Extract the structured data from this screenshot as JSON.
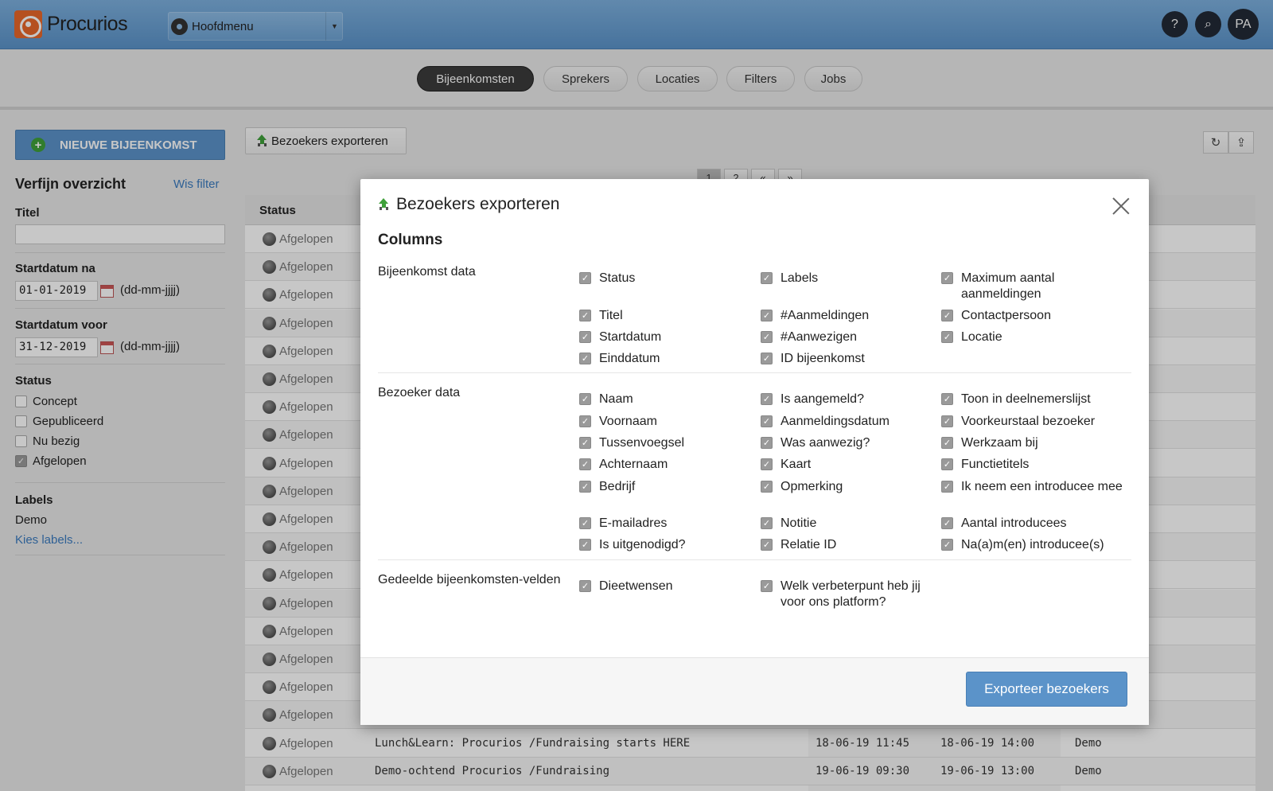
{
  "header": {
    "brand": "Procurios",
    "main_menu": "Hoofdmenu",
    "help": "?",
    "search": "⌕",
    "avatar_initials": "PA"
  },
  "tabs": [
    "Bijeenkomsten",
    "Sprekers",
    "Locaties",
    "Filters",
    "Jobs"
  ],
  "active_tab": "Bijeenkomsten",
  "sidebar": {
    "new_button": "NIEUWE BIJEENKOMST",
    "refine_title": "Verfijn overzicht",
    "clear_filter": "Wis filter",
    "title_label": "Titel",
    "title_value": "",
    "start_after_label": "Startdatum na",
    "start_after_value": "01-01-2019",
    "start_before_label": "Startdatum voor",
    "start_before_value": "31-12-2019",
    "date_hint": "(dd-mm-jjjj)",
    "status_label": "Status",
    "statuses": [
      {
        "label": "Concept",
        "checked": false
      },
      {
        "label": "Gepubliceerd",
        "checked": false
      },
      {
        "label": "Nu bezig",
        "checked": false
      },
      {
        "label": "Afgelopen",
        "checked": true
      }
    ],
    "labels_label": "Labels",
    "labels_value": "Demo",
    "choose_labels": "Kies labels..."
  },
  "content": {
    "export_button": "Bezoekers exporteren",
    "pages": [
      "1",
      "2",
      "«",
      "»"
    ],
    "status_header": "Status",
    "rows": [
      {
        "status": "Afgelopen",
        "title": "",
        "start": "",
        "end": "",
        "label": ""
      },
      {
        "status": "Afgelopen",
        "title": "",
        "start": "",
        "end": "",
        "label": ""
      },
      {
        "status": "Afgelopen",
        "title": "",
        "start": "",
        "end": "",
        "label": ""
      },
      {
        "status": "Afgelopen",
        "title": "",
        "start": "",
        "end": "",
        "label": ""
      },
      {
        "status": "Afgelopen",
        "title": "",
        "start": "",
        "end": "",
        "label": ""
      },
      {
        "status": "Afgelopen",
        "title": "",
        "start": "",
        "end": "",
        "label": ""
      },
      {
        "status": "Afgelopen",
        "title": "",
        "start": "",
        "end": "",
        "label": ""
      },
      {
        "status": "Afgelopen",
        "title": "",
        "start": "",
        "end": "",
        "label": ""
      },
      {
        "status": "Afgelopen",
        "title": "",
        "start": "",
        "end": "",
        "label": ""
      },
      {
        "status": "Afgelopen",
        "title": "",
        "start": "",
        "end": "",
        "label": ""
      },
      {
        "status": "Afgelopen",
        "title": "",
        "start": "",
        "end": "",
        "label": ""
      },
      {
        "status": "Afgelopen",
        "title": "",
        "start": "",
        "end": "",
        "label": ""
      },
      {
        "status": "Afgelopen",
        "title": "",
        "start": "",
        "end": "",
        "label": ""
      },
      {
        "status": "Afgelopen",
        "title": "",
        "start": "",
        "end": "",
        "label": ""
      },
      {
        "status": "Afgelopen",
        "title": "",
        "start": "",
        "end": "",
        "label": ""
      },
      {
        "status": "Afgelopen",
        "title": "",
        "start": "",
        "end": "",
        "label": ""
      },
      {
        "status": "Afgelopen",
        "title": "",
        "start": "",
        "end": "",
        "label": ""
      },
      {
        "status": "Afgelopen",
        "title": "",
        "start": "",
        "end": "",
        "label": ""
      },
      {
        "status": "Afgelopen",
        "title": "Lunch&Learn: Procurios /Fundraising starts HERE",
        "start": "18-06-19 11:45",
        "end": "18-06-19 14:00",
        "label": "Demo"
      },
      {
        "status": "Afgelopen",
        "title": "Demo-ochtend Procurios /Fundraising",
        "start": "19-06-19 09:30",
        "end": "19-06-19 13:00",
        "label": "Demo"
      }
    ]
  },
  "modal": {
    "title": "Bezoekers exporteren",
    "section_title": "Columns",
    "groups": [
      {
        "label": "Bijeenkomst data",
        "columns": [
          [
            "Status",
            "Titel",
            "Startdatum",
            "Einddatum"
          ],
          [
            "Labels",
            "#Aanmeldingen",
            "#Aanwezigen",
            "ID bijeenkomst"
          ],
          [
            "Maximum aantal aanmeldingen",
            "Contactpersoon",
            "Locatie"
          ]
        ]
      },
      {
        "label": "Bezoeker data",
        "columns": [
          [
            "Naam",
            "Voornaam",
            "Tussenvoegsel",
            "Achternaam",
            "Bedrijf",
            "E-mailadres",
            "Is uitgenodigd?"
          ],
          [
            "Is aangemeld?",
            "Aanmeldingsdatum",
            "Was aanwezig?",
            "Kaart",
            "Opmerking",
            "Notitie",
            "Relatie ID"
          ],
          [
            "Toon in deelnemerslijst",
            "Voorkeurstaal bezoeker",
            "Werkzaam bij",
            "Functietitels",
            "Ik neem een introducee mee",
            "Aantal introducees",
            "Na(a)m(en) introducee(s)"
          ]
        ]
      },
      {
        "label": "Gedeelde bijeenkomsten-velden",
        "columns": [
          [
            "Dieetwensen"
          ],
          [
            "Welk verbeterpunt heb jij voor ons platform?"
          ],
          []
        ]
      }
    ],
    "export_button": "Exporteer bezoekers"
  }
}
